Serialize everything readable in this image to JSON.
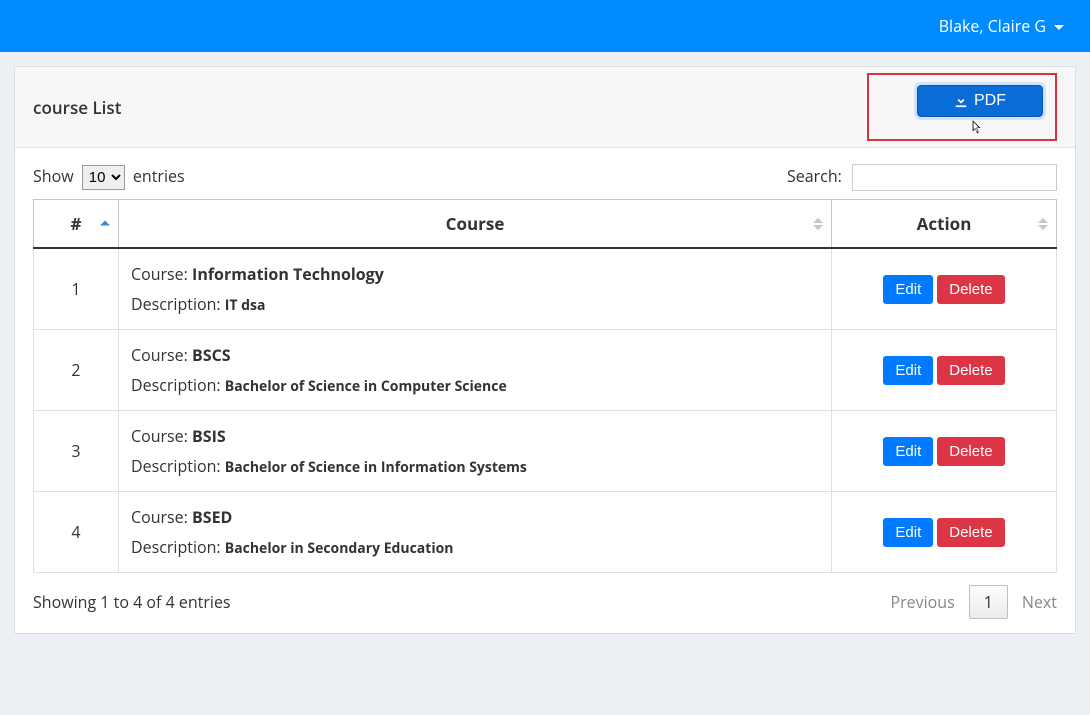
{
  "header": {
    "user_name": "Blake, Claire G"
  },
  "panel": {
    "title": "course List",
    "pdf_label": "PDF"
  },
  "toolbar": {
    "show_label": "Show",
    "entries_label": "entries",
    "page_size": "10",
    "search_label": "Search:",
    "search_value": ""
  },
  "table": {
    "headers": {
      "num": "#",
      "course": "Course",
      "action": "Action"
    },
    "labels": {
      "course": "Course:",
      "description": "Description:",
      "edit": "Edit",
      "delete": "Delete"
    },
    "rows": [
      {
        "num": "1",
        "name": "Information Technology",
        "desc": "IT dsa"
      },
      {
        "num": "2",
        "name": "BSCS",
        "desc": "Bachelor of Science in Computer Science"
      },
      {
        "num": "3",
        "name": "BSIS",
        "desc": "Bachelor of Science in Information Systems"
      },
      {
        "num": "4",
        "name": "BSED",
        "desc": "Bachelor in Secondary Education"
      }
    ]
  },
  "footer": {
    "info": "Showing 1 to 4 of 4 entries",
    "prev": "Previous",
    "page": "1",
    "next": "Next"
  }
}
